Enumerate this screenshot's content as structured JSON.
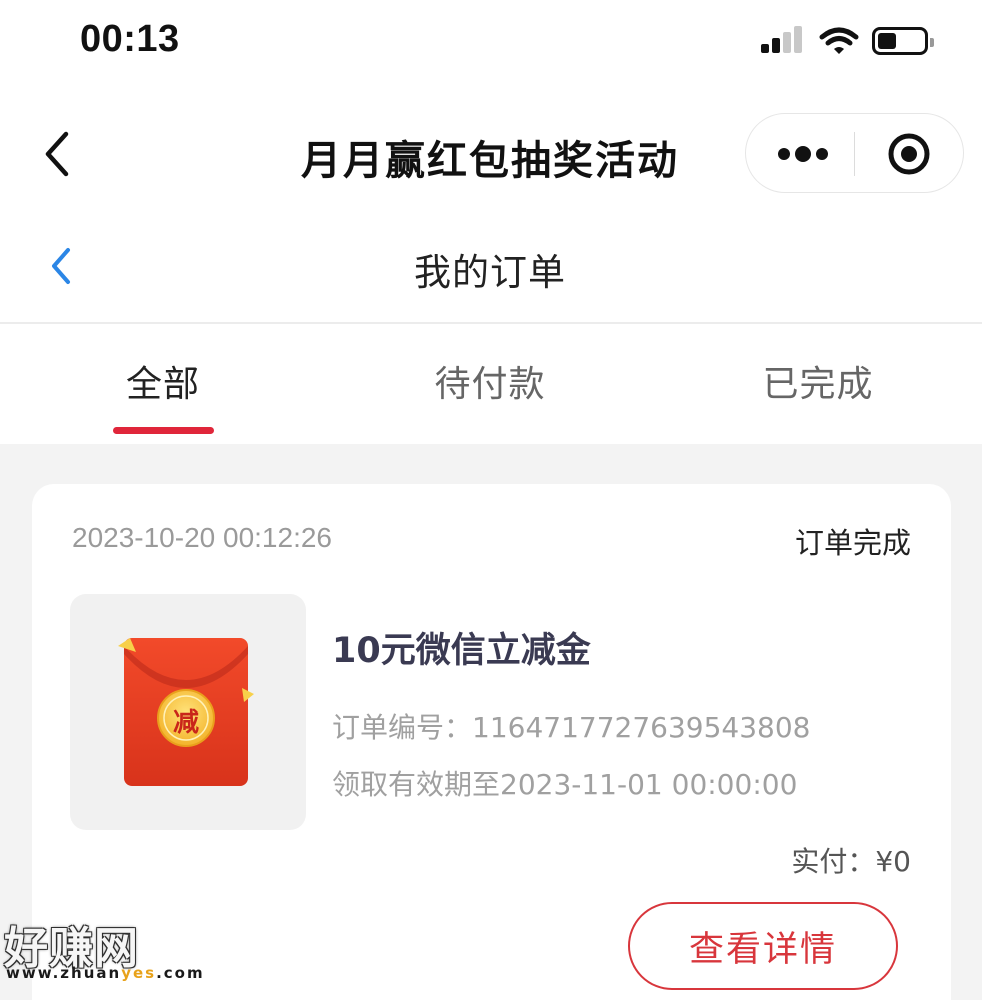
{
  "status_bar": {
    "time": "00:13",
    "icons": [
      "signal-icon",
      "wifi-icon",
      "battery-icon"
    ]
  },
  "nav": {
    "title": "月月赢红包抽奖活动",
    "icons": [
      "back-chevron-icon",
      "more-dots-icon",
      "close-target-icon"
    ]
  },
  "page": {
    "title": "我的订单"
  },
  "tabs": [
    {
      "label": "全部",
      "active": true
    },
    {
      "label": "待付款",
      "active": false
    },
    {
      "label": "已完成",
      "active": false
    }
  ],
  "order": {
    "time": "2023-10-20 00:12:26",
    "status": "订单完成",
    "product_name": "10元微信立减金",
    "order_no": "订单编号：1164717727639543808",
    "valid_until": "领取有效期至2023-11-01 00:00:00",
    "paid": "实付：¥0",
    "detail_button": "查看详情",
    "thumb_badge": "减"
  },
  "watermark": {
    "logo": "好赚网",
    "url_prefix": "www.zhuan",
    "url_highlight": "yes",
    "url_suffix": ".com"
  },
  "colors": {
    "accent_red": "#e0263a",
    "button_red": "#d8363c",
    "page_bg": "#f3f3f3",
    "product_name": "#3a3a52"
  }
}
